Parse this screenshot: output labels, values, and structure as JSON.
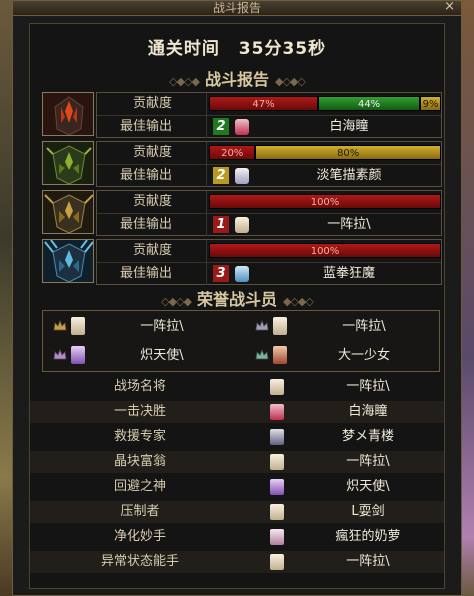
{
  "window": {
    "title": "战斗报告",
    "close_glyph": "×"
  },
  "clear_time": {
    "label": "通关时间",
    "value": "35分35秒"
  },
  "battle_report": {
    "title": "战斗报告",
    "contribution_label": "贡献度",
    "best_output_label": "最佳输出",
    "players": [
      {
        "portrait": "flame-helmet-icon",
        "contribution": [
          {
            "text": "47%",
            "value": 47,
            "color": "red"
          },
          {
            "text": "44%",
            "value": 44,
            "color": "green"
          },
          {
            "text": "9%",
            "value": 9,
            "color": "yellow"
          }
        ],
        "rank": "2",
        "rank_color": "green",
        "best_output_name": "白海瞳"
      },
      {
        "portrait": "green-helmet-icon",
        "contribution": [
          {
            "text": "20%",
            "value": 20,
            "color": "red"
          },
          {
            "text": "80%",
            "value": 80,
            "color": "yellow"
          }
        ],
        "rank": "2",
        "rank_color": "yellow",
        "best_output_name": "淡笔描素颜"
      },
      {
        "portrait": "gold-helmet-icon",
        "contribution": [
          {
            "text": "100%",
            "value": 100,
            "color": "red"
          }
        ],
        "rank": "1",
        "rank_color": "red",
        "best_output_name": "一阵拉\\"
      },
      {
        "portrait": "ice-helmet-icon",
        "contribution": [
          {
            "text": "100%",
            "value": 100,
            "color": "red"
          }
        ],
        "rank": "3",
        "rank_color": "red",
        "best_output_name": "蓝拳狂魔"
      }
    ]
  },
  "honor": {
    "title": "荣誉战斗员",
    "fighters": [
      {
        "name": "一阵拉\\"
      },
      {
        "name": "一阵拉\\"
      },
      {
        "name": "炽天使\\"
      },
      {
        "name": "大一少女"
      }
    ]
  },
  "titles": [
    {
      "title": "战场名将",
      "player": "一阵拉\\"
    },
    {
      "title": "一击决胜",
      "player": "白海瞳"
    },
    {
      "title": "救援专家",
      "player": "梦メ青楼"
    },
    {
      "title": "晶块富翁",
      "player": "一阵拉\\"
    },
    {
      "title": "回避之神",
      "player": "炽天使\\"
    },
    {
      "title": "压制者",
      "player": "L耍剑"
    },
    {
      "title": "净化妙手",
      "player": "瘋狂的奶萝"
    },
    {
      "title": "异常状态能手",
      "player": "一阵拉\\"
    }
  ],
  "colors": {
    "bar_red": "#b01818",
    "bar_green": "#30a030",
    "bar_yellow": "#d0b030",
    "text_main": "#f0ead8",
    "frame": "#6e5c3c"
  }
}
